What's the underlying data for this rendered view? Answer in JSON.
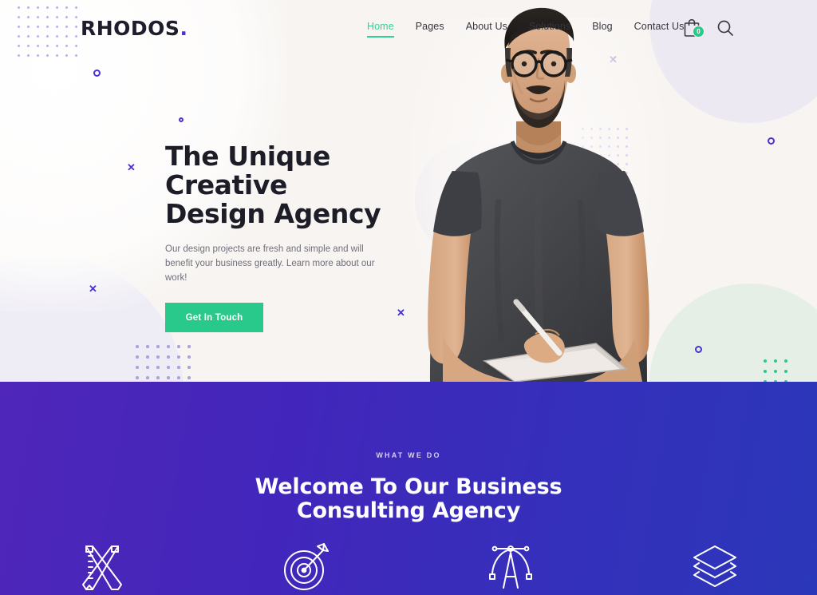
{
  "header": {
    "logo_text": "RHODOS",
    "logo_dot": ".",
    "nav": [
      {
        "label": "Home",
        "active": true
      },
      {
        "label": "Pages",
        "active": false
      },
      {
        "label": "About Us",
        "active": false
      },
      {
        "label": "Solutions",
        "active": false
      },
      {
        "label": "Blog",
        "active": false
      },
      {
        "label": "Contact Us",
        "active": false
      }
    ],
    "cart_icon": "shopping-bag-icon",
    "cart_count": "0",
    "search_icon": "search-icon"
  },
  "hero": {
    "title_line1": "The Unique Creative",
    "title_line2": "Design Agency",
    "subtitle": "Our design projects are fresh and simple and will benefit your business greatly. Learn more about our work!",
    "cta_label": "Get In Touch",
    "photo_alt": "man-with-glasses-holding-tablet"
  },
  "what_we_do": {
    "eyebrow": "WHAT WE DO",
    "title_line1": "Welcome To Our Business",
    "title_line2": "Consulting Agency",
    "services": [
      {
        "icon": "ruler-pencil-icon"
      },
      {
        "icon": "target-arrow-icon"
      },
      {
        "icon": "typography-bezier-icon"
      },
      {
        "icon": "layers-icon"
      }
    ]
  },
  "colors": {
    "accent_green": "#28c98a",
    "nav_active": "#2fd293",
    "purple": "#4733cf",
    "hero_bg": "#f7f4f1",
    "section_gradient_start": "#4f26b9",
    "section_gradient_end": "#2b37b9",
    "heading_dark": "#1d1d27"
  }
}
